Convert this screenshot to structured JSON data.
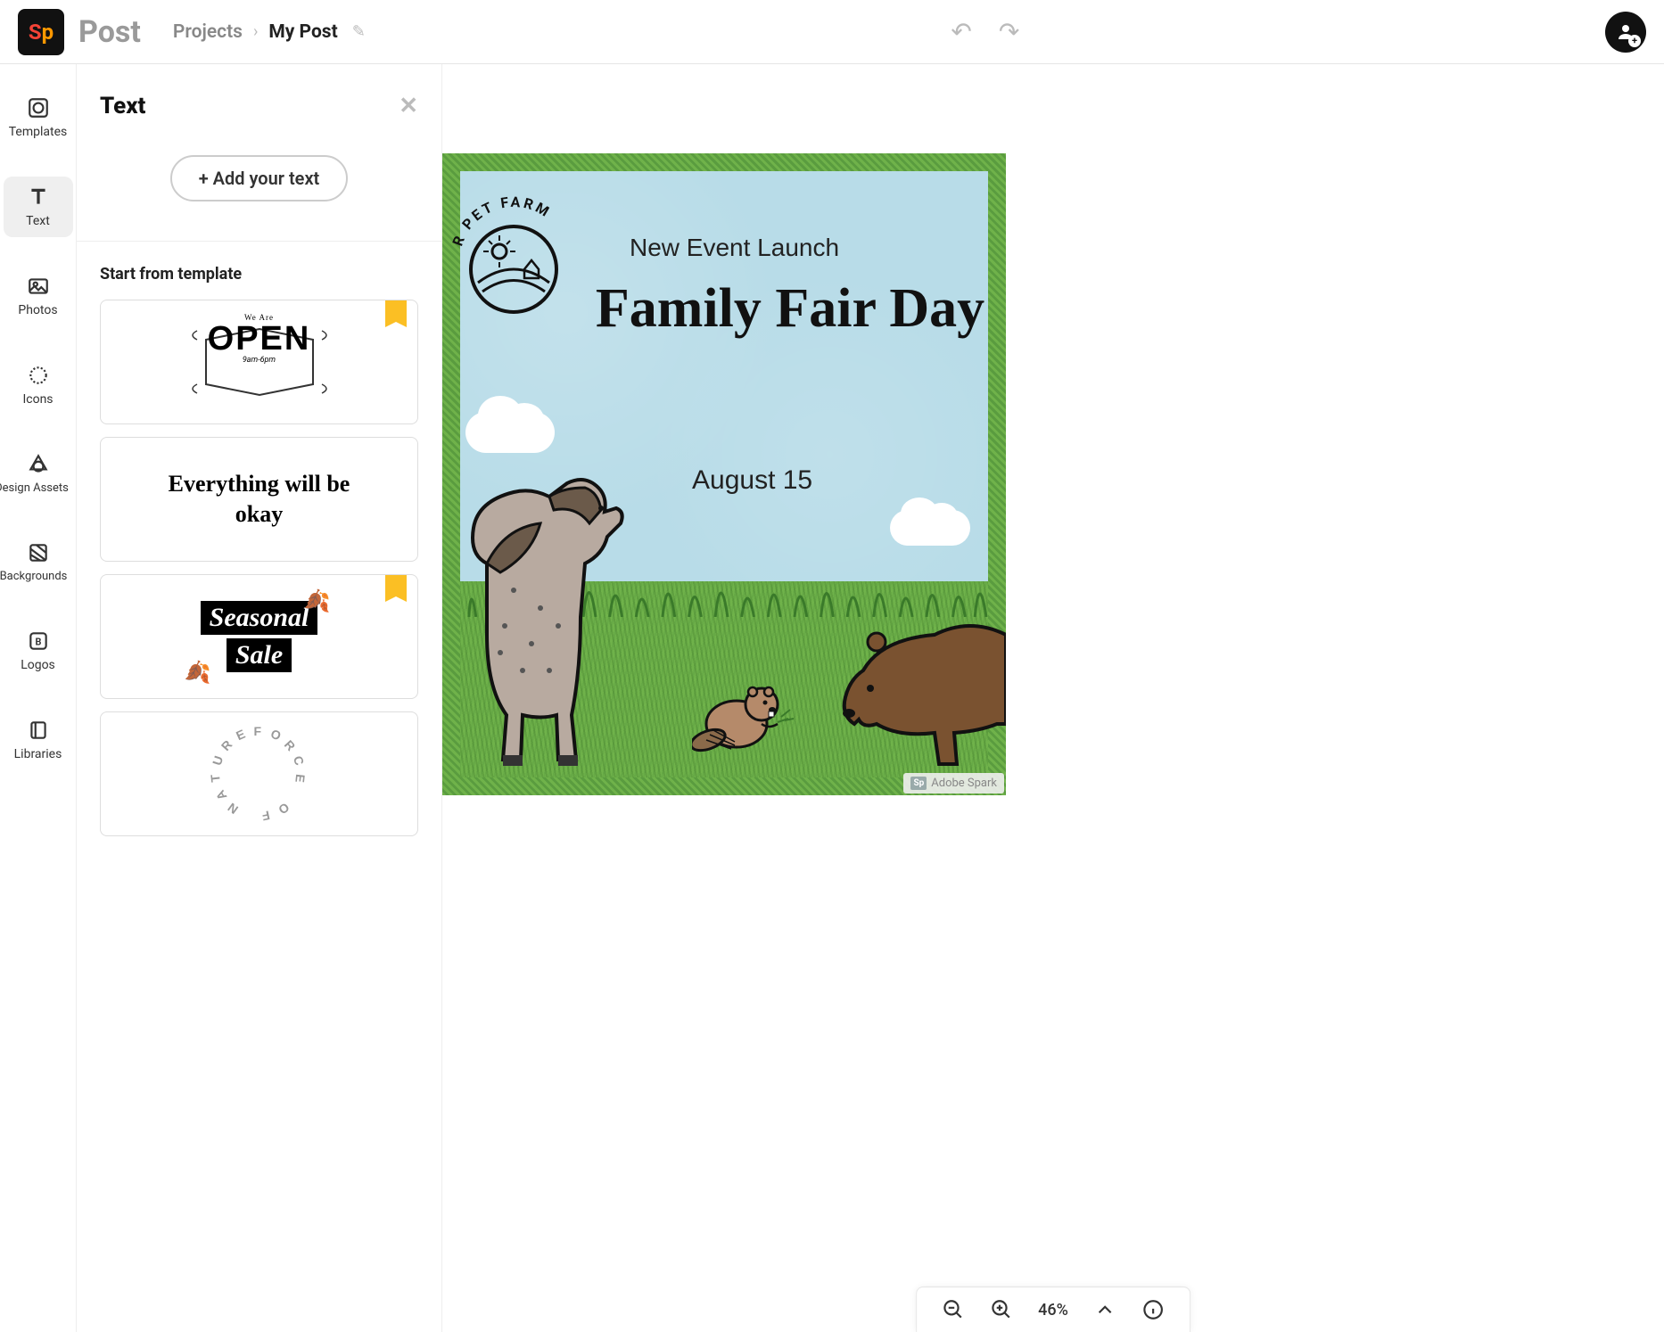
{
  "header": {
    "app_name": "Post",
    "breadcrumb_root": "Projects",
    "breadcrumb_current": "My Post"
  },
  "rail": {
    "templates": "Templates",
    "text": "Text",
    "photos": "Photos",
    "icons": "Icons",
    "design_assets": "Design Assets",
    "backgrounds": "Backgrounds",
    "logos": "Logos",
    "libraries": "Libraries"
  },
  "panel": {
    "title": "Text",
    "add_button": "+ Add your text",
    "section_title": "Start from template",
    "templates": {
      "open_weare": "We Are",
      "open_main": "OPEN",
      "open_hours": "9am-6pm",
      "okay": "Everything will be okay",
      "seasonal_1": "Seasonal",
      "seasonal_2": "Sale",
      "force": "FORCE OF NATURE"
    }
  },
  "canvas": {
    "farm_label_part": "R  PET  FARM",
    "event_kicker": "New Event Launch",
    "event_title": "Family Fair Day",
    "event_date": "August 15",
    "watermark": "Adobe Spark"
  },
  "zoom": {
    "value": "46%"
  }
}
